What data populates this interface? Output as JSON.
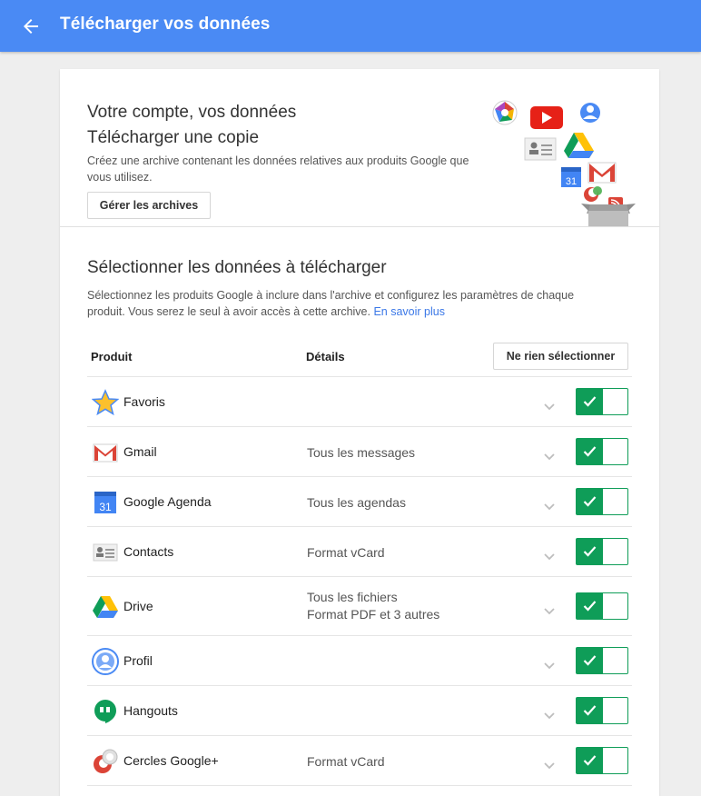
{
  "header": {
    "title": "Télécharger vos données"
  },
  "hero": {
    "title_line1": "Votre compte, vos données",
    "title_line2": "Télécharger une copie",
    "description": "Créez une archive contenant les données relatives aux produits Google que vous utilisez.",
    "manage_button": "Gérer les archives",
    "calendar_day": "31"
  },
  "selection": {
    "title": "Sélectionner les données à télécharger",
    "description": "Sélectionnez les produits Google à inclure dans l'archive et configurez les paramètres de chaque produit. Vous serez le seul à avoir accès à cette archive.",
    "learn_more": "En savoir plus"
  },
  "table": {
    "col_product": "Produit",
    "col_details": "Détails",
    "select_none_button": "Ne rien sélectionner",
    "rows": [
      {
        "name": "Favoris",
        "details": "",
        "details2": "",
        "icon": "star-icon",
        "selected": true
      },
      {
        "name": "Gmail",
        "details": "Tous les messages",
        "details2": "",
        "icon": "gmail-icon",
        "selected": true
      },
      {
        "name": "Google Agenda",
        "details": "Tous les agendas",
        "details2": "",
        "icon": "calendar-icon",
        "selected": true
      },
      {
        "name": "Contacts",
        "details": "Format vCard",
        "details2": "",
        "icon": "contacts-icon",
        "selected": true
      },
      {
        "name": "Drive",
        "details": "Tous les fichiers",
        "details2": "Format PDF et 3 autres",
        "icon": "drive-icon",
        "selected": true
      },
      {
        "name": "Profil",
        "details": "",
        "details2": "",
        "icon": "profile-icon",
        "selected": true
      },
      {
        "name": "Hangouts",
        "details": "",
        "details2": "",
        "icon": "hangouts-icon",
        "selected": true
      },
      {
        "name": "Cercles Google+",
        "details": "Format vCard",
        "details2": "",
        "icon": "circles-icon",
        "selected": true
      }
    ]
  },
  "colors": {
    "header_blue": "#4a8af4",
    "toggle_green": "#0f9d58",
    "link_blue": "#3b78e7"
  }
}
